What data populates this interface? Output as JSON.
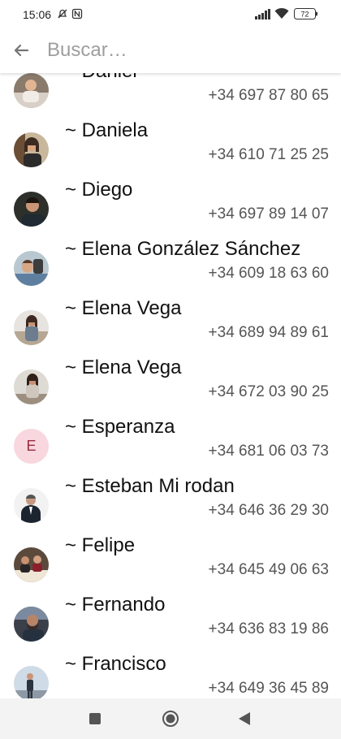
{
  "status_bar": {
    "time": "15:06",
    "battery": "72"
  },
  "search": {
    "placeholder": "Buscar…"
  },
  "contacts": [
    {
      "name": "~ Daniel",
      "phone": "+34 697 87 80 65"
    },
    {
      "name": "~ Daniela",
      "phone": "+34 610 71 25 25"
    },
    {
      "name": "~ Diego",
      "phone": "+34 697 89 14 07"
    },
    {
      "name": "~ Elena González Sánchez",
      "phone": "+34 609 18 63 60"
    },
    {
      "name": "~ Elena Vega",
      "phone": "+34 689 94 89 61"
    },
    {
      "name": "~ Elena Vega",
      "phone": "+34 672 03 90 25"
    },
    {
      "name": "~ Esperanza",
      "phone": "+34 681 06 03 73",
      "initial": "E"
    },
    {
      "name": "~ Esteban Mi rodan",
      "phone": "+34 646 36 29 30"
    },
    {
      "name": "~ Felipe",
      "phone": "+34 645 49 06 63"
    },
    {
      "name": "~ Fernando",
      "phone": "+34 636 83 19 86"
    },
    {
      "name": "~ Francisco",
      "phone": "+34 649 36 45 89"
    }
  ],
  "colors": {
    "accent": "#1a73e8",
    "initial_bg": "#f8d7de",
    "initial_fg": "#9a2b40"
  }
}
